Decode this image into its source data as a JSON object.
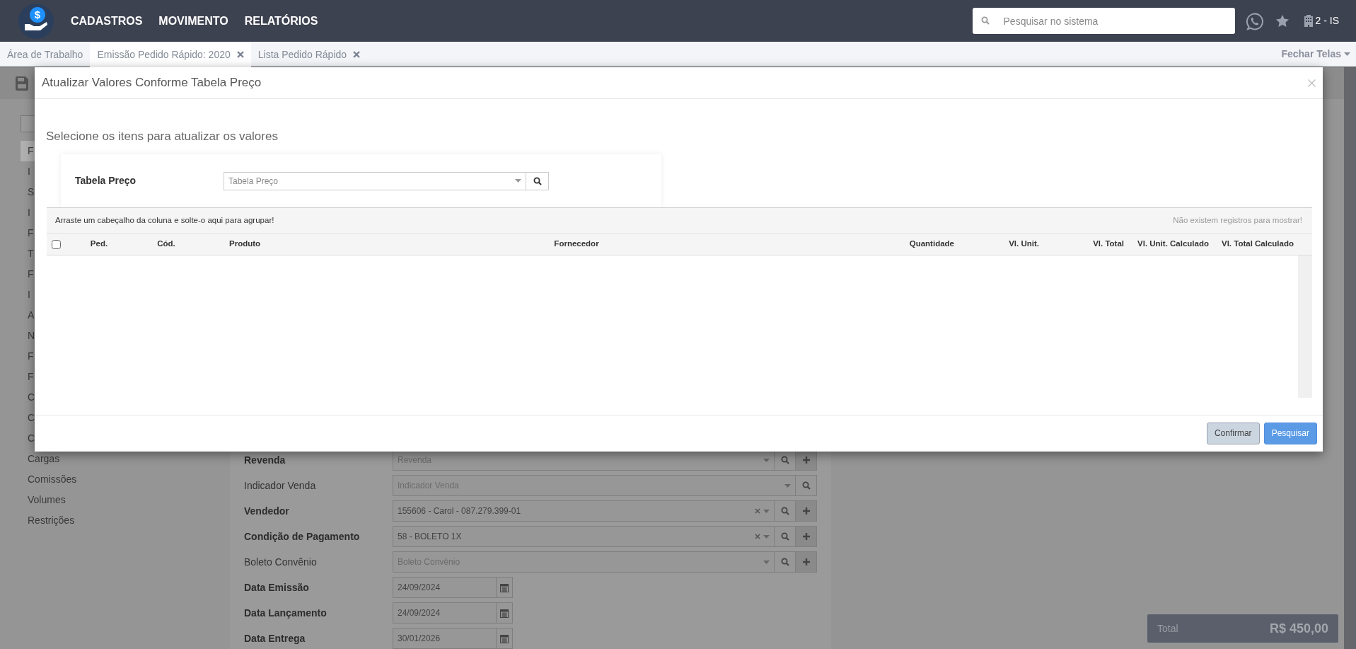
{
  "topbar": {
    "menu": [
      "CADASTROS",
      "MOVIMENTO",
      "RELATÓRIOS"
    ],
    "logo_symbol": "$",
    "search": {
      "placeholder": "Pesquisar no sistema"
    },
    "company": "2 - IS"
  },
  "tabs": [
    {
      "label": "Área de Trabalho",
      "selected": false,
      "closable": false
    },
    {
      "label": "Emissão Pedido Rápido: 2020",
      "selected": true,
      "closable": true
    },
    {
      "label": "Lista Pedido Rápido",
      "selected": false,
      "closable": true
    }
  ],
  "close_screens": "Fechar Telas",
  "sidebar": {
    "items": [
      {
        "label": "F",
        "selected": true
      },
      {
        "label": "I",
        "selected": false
      },
      {
        "label": "S",
        "selected": false
      },
      {
        "label": "I",
        "selected": false
      },
      {
        "label": "F",
        "selected": false
      },
      {
        "label": "T",
        "selected": false
      },
      {
        "label": "F",
        "selected": false
      },
      {
        "label": "I",
        "selected": false
      },
      {
        "label": "A",
        "selected": false
      },
      {
        "label": "N",
        "selected": false
      },
      {
        "label": "F",
        "selected": false
      },
      {
        "label": "F",
        "selected": false
      },
      {
        "label": "C",
        "selected": false
      },
      {
        "label": "C",
        "selected": false
      },
      {
        "label": "C",
        "selected": false
      },
      {
        "label": "Cargas",
        "selected": false
      },
      {
        "label": "Comissões",
        "selected": false
      },
      {
        "label": "Volumes",
        "selected": false
      },
      {
        "label": "Restrições",
        "selected": false
      }
    ]
  },
  "form": {
    "fields": [
      {
        "label": "Revenda",
        "kind": "select",
        "required": true,
        "placeholder": "Revenda",
        "clearable": false,
        "add": true
      },
      {
        "label": "Indicador Venda",
        "kind": "select",
        "required": false,
        "placeholder": "Indicador Venda",
        "clearable": false,
        "add": false
      },
      {
        "label": "Vendedor",
        "kind": "select",
        "required": true,
        "value": "155606 - Carol - 087.279.399-01",
        "clearable": true,
        "add": true
      },
      {
        "label": "Condição de Pagamento",
        "kind": "select",
        "required": true,
        "value": "58 - BOLETO 1X",
        "clearable": true,
        "add": true
      },
      {
        "label": "Boleto Convênio",
        "kind": "select",
        "required": false,
        "placeholder": "Boleto Convênio",
        "clearable": false,
        "add": true
      },
      {
        "label": "Data Emissão",
        "kind": "date",
        "required": true,
        "value": "24/09/2024"
      },
      {
        "label": "Data Lançamento",
        "kind": "date",
        "required": true,
        "value": "24/09/2024"
      },
      {
        "label": "Data Entrega",
        "kind": "date",
        "required": true,
        "value": "30/01/2026"
      }
    ]
  },
  "total": {
    "label": "Total",
    "value": "R$ 450,00"
  },
  "modal": {
    "title": "Atualizar Valores Conforme Tabela Preço",
    "subtitle": "Selecione os itens para atualizar os valores",
    "filter": {
      "label": "Tabela Preço",
      "placeholder": "Tabela Preço"
    },
    "grid": {
      "group_hint": "Arraste um cabeçalho da coluna e solte-o aqui para agrupar!",
      "empty_message": "Não existem registros para mostrar!",
      "all_selected": false,
      "columns": [
        {
          "label": "Ped."
        },
        {
          "label": "Cód."
        },
        {
          "label": "Produto"
        },
        {
          "label": "Fornecedor"
        },
        {
          "label": "Quantidade"
        },
        {
          "label": "Vl. Unit."
        },
        {
          "label": "Vl. Total"
        },
        {
          "label": "Vl. Unit. Calculado"
        },
        {
          "label": "Vl. Total Calculado"
        }
      ]
    },
    "buttons": [
      {
        "label": "Confirmar",
        "kind": "secondary"
      },
      {
        "label": "Pesquisar",
        "kind": "primary"
      }
    ]
  }
}
